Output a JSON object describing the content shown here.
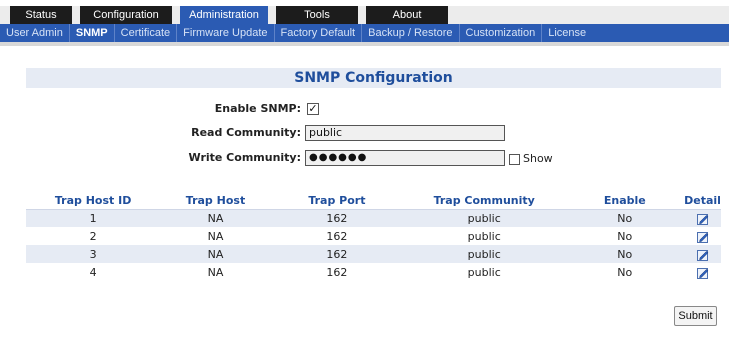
{
  "top_tabs": [
    {
      "label": "Status"
    },
    {
      "label": "Configuration"
    },
    {
      "label": "Administration"
    },
    {
      "label": "Tools"
    },
    {
      "label": "About"
    }
  ],
  "active_top_tab": "Administration",
  "sub_nav": [
    {
      "label": "User Admin"
    },
    {
      "label": "SNMP"
    },
    {
      "label": "Certificate"
    },
    {
      "label": "Firmware Update"
    },
    {
      "label": "Factory Default"
    },
    {
      "label": "Backup / Restore"
    },
    {
      "label": "Customization"
    },
    {
      "label": "License"
    }
  ],
  "active_sub_nav": "SNMP",
  "section_title": "SNMP Configuration",
  "form": {
    "enable_snmp": {
      "label": "Enable SNMP:",
      "checked": true
    },
    "read_community": {
      "label": "Read Community:",
      "value": "public"
    },
    "write_community": {
      "label": "Write Community:",
      "value": "●●●●●●"
    },
    "show": {
      "label": "Show",
      "checked": false
    }
  },
  "trap_table": {
    "headers": [
      "Trap Host ID",
      "Trap Host",
      "Trap Port",
      "Trap Community",
      "Enable",
      "Detail"
    ],
    "rows": [
      {
        "id": "1",
        "host": "NA",
        "port": "162",
        "community": "public",
        "enable": "No"
      },
      {
        "id": "2",
        "host": "NA",
        "port": "162",
        "community": "public",
        "enable": "No"
      },
      {
        "id": "3",
        "host": "NA",
        "port": "162",
        "community": "public",
        "enable": "No"
      },
      {
        "id": "4",
        "host": "NA",
        "port": "162",
        "community": "public",
        "enable": "No"
      }
    ]
  },
  "submit_label": "Submit",
  "colors": {
    "nav_blue": "#2b5bb3",
    "title_blue": "#1f4e9c",
    "stripe": "#e6ebf4"
  }
}
